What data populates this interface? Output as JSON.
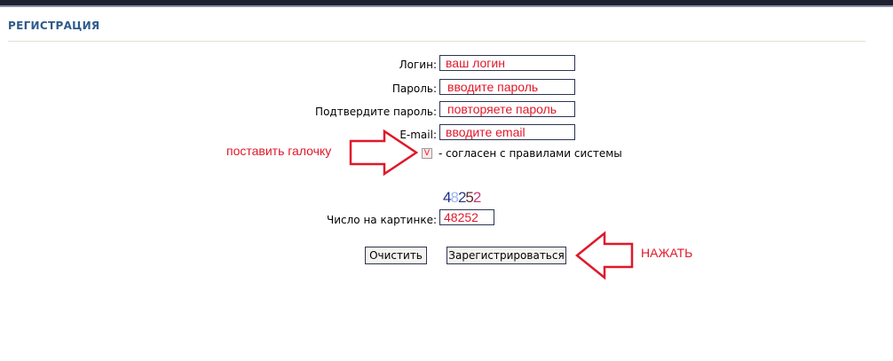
{
  "section": {
    "title": "РЕГИСТРАЦИЯ"
  },
  "form": {
    "login_label": "Логин:",
    "login_value": "ваш логин",
    "password_label": "Пароль:",
    "password_value": "вводите пароль",
    "confirm_label": "Подтвердите пароль:",
    "confirm_value": "повторяете пароль",
    "email_label": "E-mail:",
    "email_value": "вводите email",
    "agree_check": "V",
    "agree_text": "- согласен с правилами системы",
    "captcha_digits": [
      "4",
      "8",
      "2",
      "5",
      "2"
    ],
    "captcha_label": "Число на картинке:",
    "captcha_value": "48252"
  },
  "buttons": {
    "clear_label": "Очистить",
    "register_label": "Зарегистрироваться"
  },
  "annotations": {
    "checkbox_hint": "поставить галочку",
    "press_hint": "НАЖАТЬ",
    "color": "#e0182a"
  }
}
